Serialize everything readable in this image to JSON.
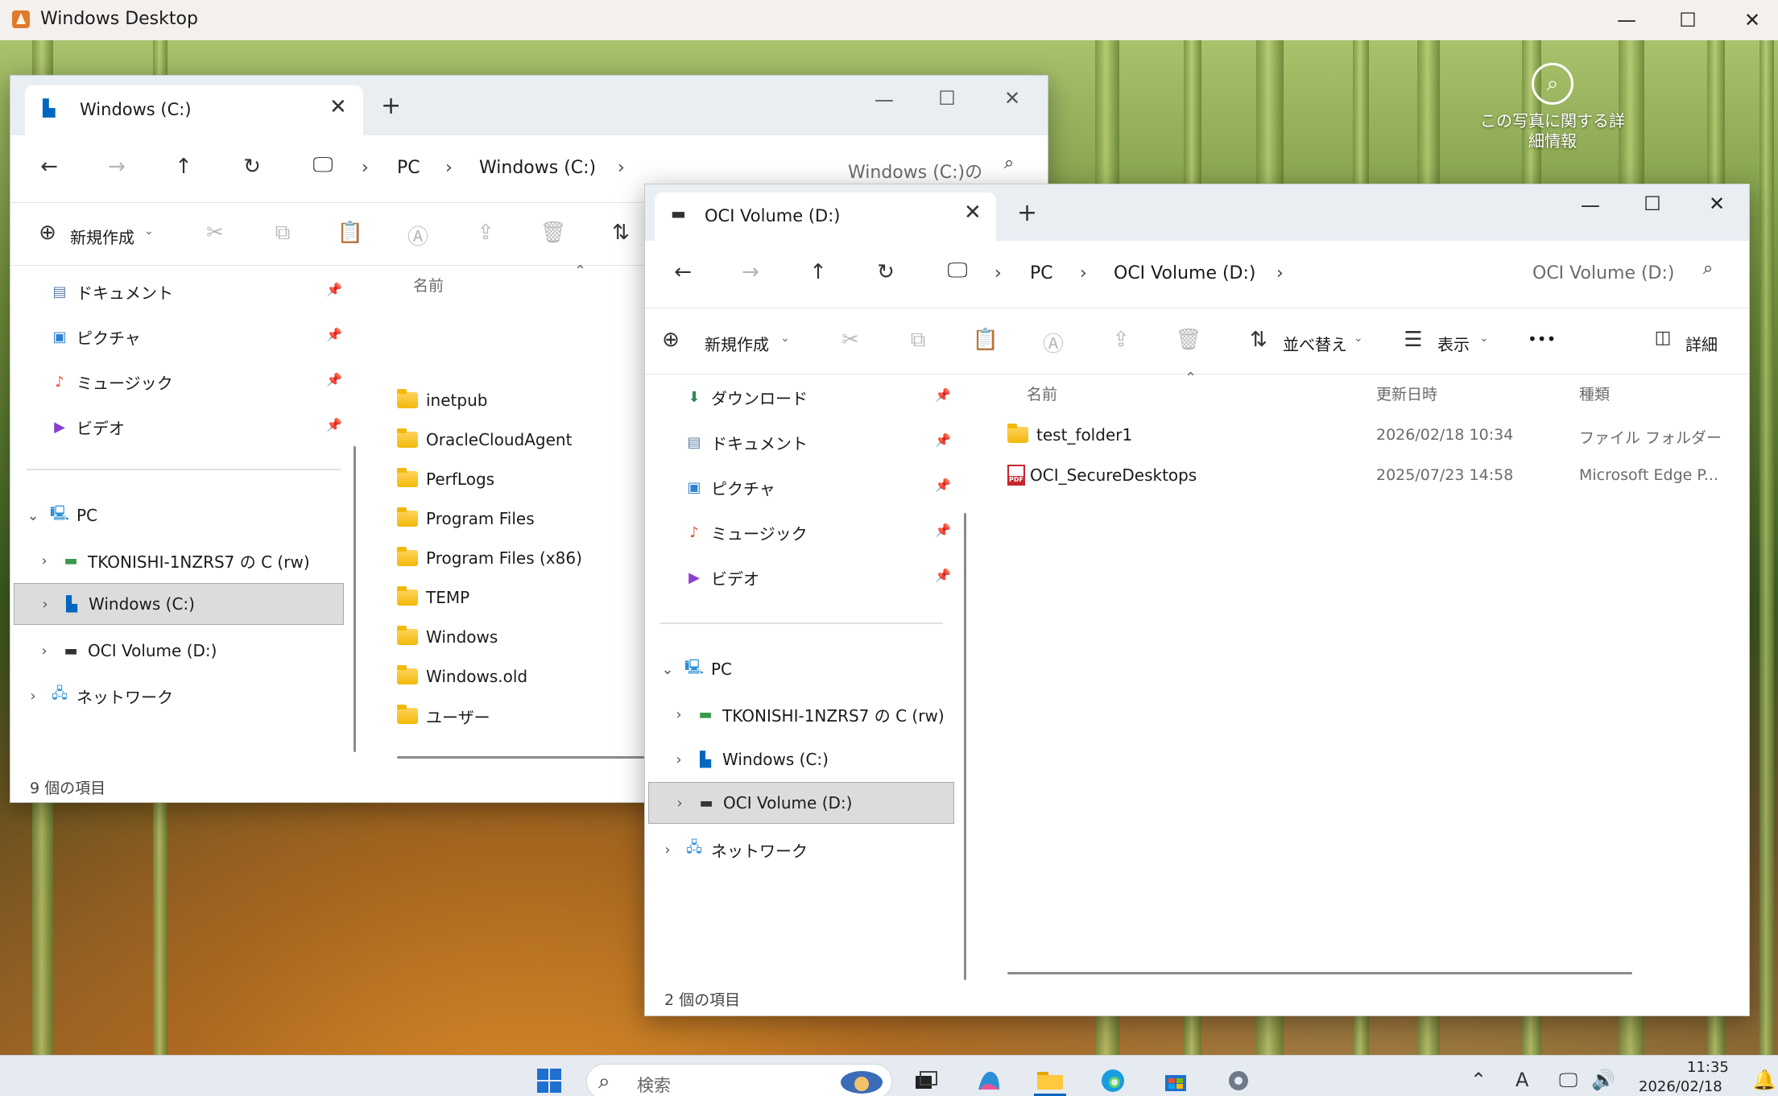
{
  "host": {
    "title": "Windows Desktop",
    "minimize": "—",
    "maximize": "☐",
    "close": "✕"
  },
  "desktop": {
    "photo_info": "この写真に関する詳細情報"
  },
  "win_c": {
    "tab_label": "Windows (C:)",
    "tab_close": "✕",
    "new_tab": "+",
    "min": "—",
    "max": "☐",
    "close": "✕",
    "nav": {
      "back": "←",
      "forward": "→",
      "up": "↑",
      "refresh": "↻",
      "monitor": "🖵"
    },
    "breadcrumb": [
      "PC",
      "Windows (C:)"
    ],
    "crumb_sep": "›",
    "search_placeholder": "Windows (C:)の",
    "new_label": "新規作成",
    "sort_icon": "⇅",
    "sidebar": {
      "quick": [
        {
          "label": "ドキュメント",
          "icon": "📄"
        },
        {
          "label": "ピクチャ",
          "icon": "🖼"
        },
        {
          "label": "ミュージック",
          "icon": "♪"
        },
        {
          "label": "ビデオ",
          "icon": "▶"
        }
      ],
      "pc": "PC",
      "drives": [
        "TKONISHI-1NZRS7 の C (rw)",
        "Windows (C:)",
        "OCI Volume (D:)"
      ],
      "network": "ネットワーク"
    },
    "column_name": "名前",
    "files": [
      "inetpub",
      "OracleCloudAgent",
      "PerfLogs",
      "Program Files",
      "Program Files (x86)",
      "TEMP",
      "Windows",
      "Windows.old",
      "ユーザー"
    ],
    "status": "9 個の項目"
  },
  "win_d": {
    "tab_label": "OCI Volume (D:)",
    "tab_close": "✕",
    "new_tab": "+",
    "min": "—",
    "max": "☐",
    "close": "✕",
    "nav": {
      "back": "←",
      "forward": "→",
      "up": "↑",
      "refresh": "↻",
      "monitor": "🖵"
    },
    "breadcrumb": [
      "PC",
      "OCI Volume (D:)"
    ],
    "crumb_sep": "›",
    "search_placeholder": "OCI Volume (D:)",
    "new_label": "新規作成",
    "sort_label": "並べ替え",
    "view_label": "表示",
    "more": "•••",
    "details_label": "詳細",
    "sidebar": {
      "quick": [
        {
          "label": "ダウンロード",
          "icon": "⬇"
        },
        {
          "label": "ドキュメント",
          "icon": "📄"
        },
        {
          "label": "ピクチャ",
          "icon": "🖼"
        },
        {
          "label": "ミュージック",
          "icon": "♪"
        },
        {
          "label": "ビデオ",
          "icon": "▶"
        }
      ],
      "pc": "PC",
      "drives": [
        "TKONISHI-1NZRS7 の C (rw)",
        "Windows (C:)",
        "OCI Volume (D:)"
      ],
      "network": "ネットワーク"
    },
    "columns": {
      "name": "名前",
      "modified": "更新日時",
      "type": "種類"
    },
    "files": [
      {
        "name": "test_folder1",
        "modified": "2026/02/18 10:34",
        "type": "ファイル フォルダー",
        "kind": "folder"
      },
      {
        "name": "OCI_SecureDesktops",
        "modified": "2025/07/23 14:58",
        "type": "Microsoft Edge P...",
        "kind": "pdf"
      }
    ],
    "status": "2 個の項目"
  },
  "taskbar": {
    "search_label": "検索",
    "time": "11:35",
    "date": "2026/02/18"
  },
  "colors": {
    "accent": "#0067c0",
    "folder": "#f2b90a",
    "pdf": "#c4262e",
    "selection": "#dcdcdc"
  }
}
